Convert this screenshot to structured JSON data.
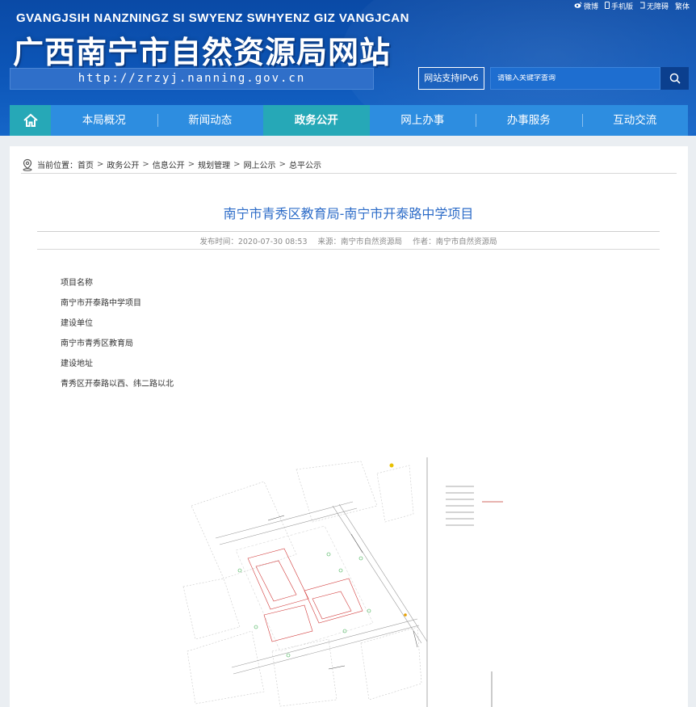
{
  "header": {
    "zhuang_title": "GVANGJSIH NANZNINGZ SI SWYENZ SWHYENZ GIZ VANGJCAN",
    "site_title": "广西南宁市自然资源局网站",
    "url": "http://zrzyj.nanning.gov.cn",
    "top_links": [
      {
        "icon": "weibo-icon",
        "label": "微博"
      },
      {
        "icon": "mobile-icon",
        "label": "手机版"
      },
      {
        "icon": "accessibility-icon",
        "label": "无障碍"
      },
      {
        "icon": "",
        "label": "繁体"
      }
    ],
    "ipv6_label": "网站支持IPv6",
    "search_placeholder": "请输入关键字查询"
  },
  "nav": {
    "home_icon": "home-icon",
    "items": [
      {
        "label": "本局概况",
        "active": false
      },
      {
        "label": "新闻动态",
        "active": false
      },
      {
        "label": "政务公开",
        "active": true
      },
      {
        "label": "网上办事",
        "active": false
      },
      {
        "label": "办事服务",
        "active": false
      },
      {
        "label": "互动交流",
        "active": false
      }
    ]
  },
  "breadcrumb": {
    "prefix": "当前位置：",
    "items": [
      "首页",
      "政务公开",
      "信息公开",
      "规划管理",
      "网上公示",
      "总平公示"
    ],
    "separator": ">"
  },
  "article": {
    "title": "南宁市青秀区教育局-南宁市开泰路中学项目",
    "publish_time": "发布时间：2020-07-30 08:53",
    "source": "来源：南宁市自然资源局",
    "author": "作者：南宁市自然资源局",
    "lines": [
      "项目名称",
      "南宁市开泰路中学项目",
      "建设单位",
      "南宁市青秀区教育局",
      "建设地址",
      "青秀区开泰路以西、纬二路以北"
    ]
  },
  "colors": {
    "header_blue": "#0d56b8",
    "nav_blue": "#2d8de0",
    "nav_active": "#26a8b7",
    "title_blue": "#2d6cc8"
  }
}
